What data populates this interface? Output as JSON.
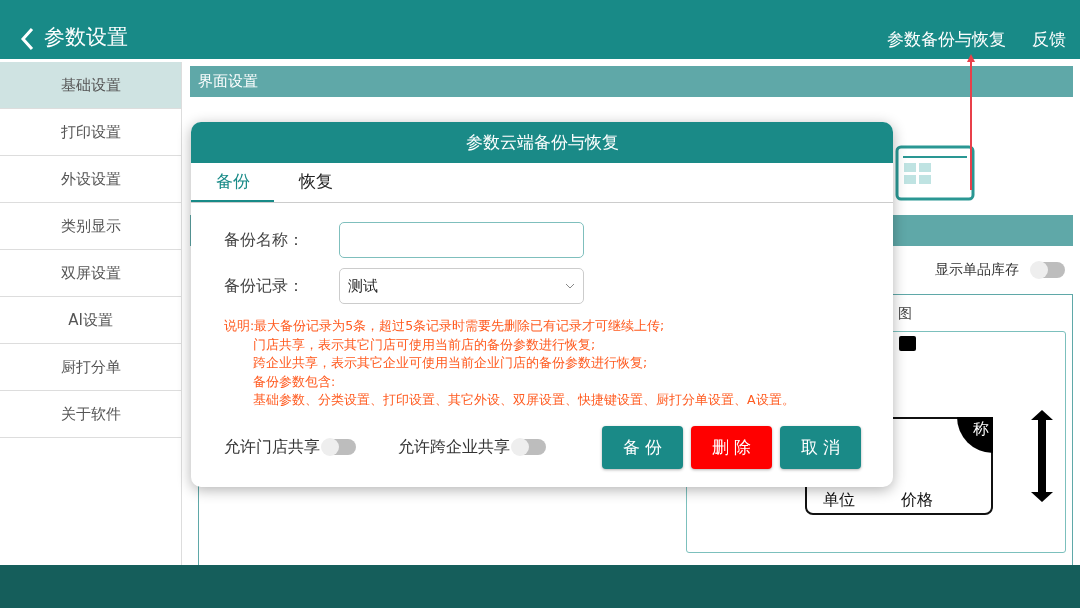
{
  "header": {
    "title": "参数设置",
    "actions": [
      "参数备份与恢复",
      "反馈"
    ]
  },
  "sidebar": {
    "items": [
      {
        "label": "基础设置",
        "selected": true
      },
      {
        "label": "打印设置",
        "selected": false
      },
      {
        "label": "外设设置",
        "selected": false
      },
      {
        "label": "类别显示",
        "selected": false
      },
      {
        "label": "双屏设置",
        "selected": false
      },
      {
        "label": "AI设置",
        "selected": false
      },
      {
        "label": "厨打分单",
        "selected": false
      },
      {
        "label": "关于软件",
        "selected": false
      }
    ]
  },
  "section": {
    "title": "界面设置"
  },
  "stock_toggle": {
    "label": "显示单品库存",
    "on": false
  },
  "preview": {
    "label": "图",
    "corner_label": "称",
    "unit_label": "单位",
    "price_label": "价格"
  },
  "dialog": {
    "title": "参数云端备份与恢复",
    "tabs": [
      {
        "label": "备份",
        "selected": true
      },
      {
        "label": "恢复",
        "selected": false
      }
    ],
    "fields": [
      {
        "kind": "input",
        "label": "备份名称："
      },
      {
        "kind": "select",
        "label": "备份记录：",
        "value": "测试"
      }
    ],
    "notes": [
      "说明:最大备份记录为5条，超过5条记录时需要先删除已有记录才可继续上传;",
      "门店共享，表示其它门店可使用当前店的备份参数进行恢复;",
      "跨企业共享，表示其它企业可使用当前企业门店的备份参数进行恢复;",
      "备份参数包含:",
      "基础参数、分类设置、打印设置、其它外设、双屏设置、快捷键设置、厨打分单设置、A设置。"
    ],
    "toggles": [
      {
        "label": "允许门店共享",
        "on": false
      },
      {
        "label": "允许跨企业共享",
        "on": false
      }
    ],
    "buttons": [
      {
        "label": "备 份",
        "kind": "primary"
      },
      {
        "label": "删 除",
        "kind": "danger"
      },
      {
        "label": "取 消",
        "kind": "primary"
      }
    ]
  }
}
